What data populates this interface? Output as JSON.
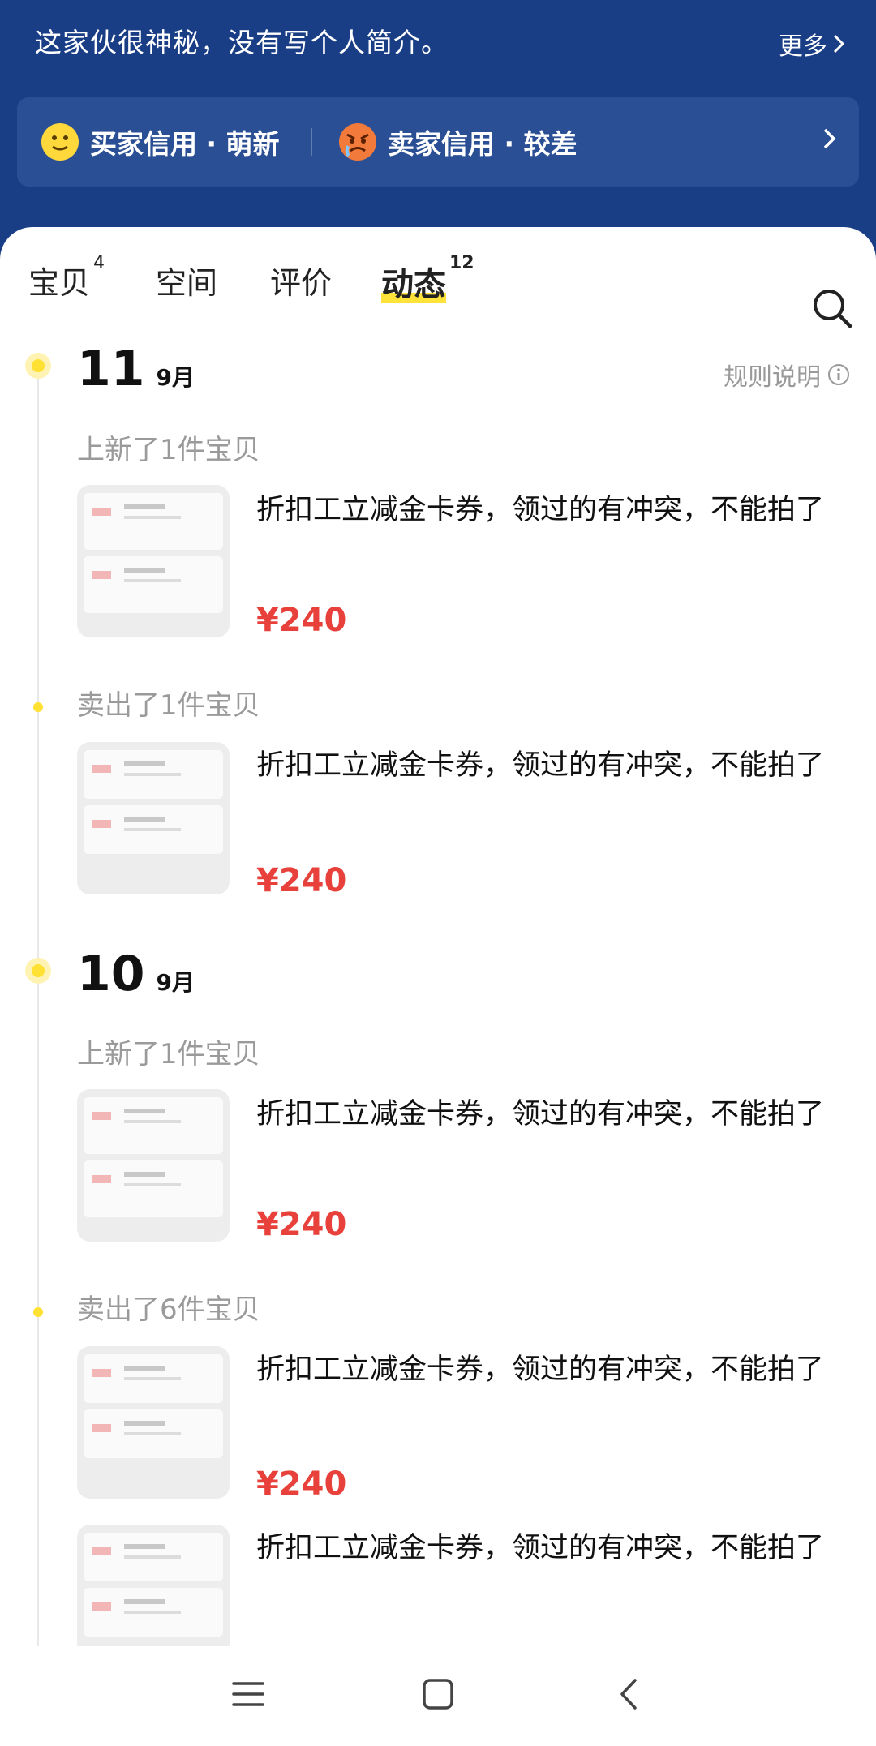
{
  "header": {
    "bio": "这家伙很神秘，没有写个人简介。",
    "more_label": "更多",
    "buyer_credit": "买家信用 · 萌新",
    "seller_credit": "卖家信用 · 较差"
  },
  "tabs": [
    {
      "label": "宝贝",
      "count": "4"
    },
    {
      "label": "空间",
      "count": ""
    },
    {
      "label": "评价",
      "count": ""
    },
    {
      "label": "动态",
      "count": "12"
    }
  ],
  "rules_label": "规则说明",
  "timeline": [
    {
      "day": "11",
      "month": "9月",
      "groups": [
        {
          "activity": "上新了1件宝贝",
          "items": [
            {
              "title": "折扣工立减金卡券，领过的有冲突，不能拍了",
              "price": "¥240"
            }
          ]
        },
        {
          "activity": "卖出了1件宝贝",
          "items": [
            {
              "title": "折扣工立减金卡券，领过的有冲突，不能拍了",
              "price": "¥240"
            }
          ]
        }
      ]
    },
    {
      "day": "10",
      "month": "9月",
      "groups": [
        {
          "activity": "上新了1件宝贝",
          "items": [
            {
              "title": "折扣工立减金卡券，领过的有冲突，不能拍了",
              "price": "¥240"
            }
          ]
        },
        {
          "activity": "卖出了6件宝贝",
          "items": [
            {
              "title": "折扣工立减金卡券，领过的有冲突，不能拍了",
              "price": "¥240"
            },
            {
              "title": "折扣工立减金卡券，领过的有冲突，不能拍了",
              "price": ""
            }
          ]
        }
      ]
    }
  ],
  "colors": {
    "header_bg": "#193e86",
    "accent_yellow": "#ffe133",
    "price_red": "#e8413b"
  }
}
